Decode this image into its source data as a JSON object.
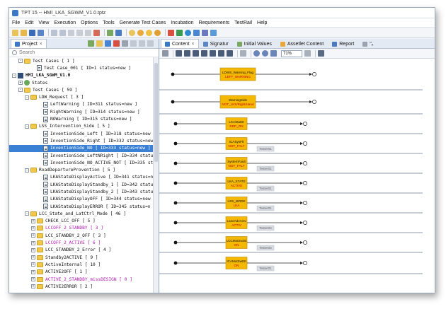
{
  "window": {
    "title": "TPT 15 -- HMI_LKA_SGWM_V1.0.tptz"
  },
  "menu": [
    "File",
    "Edit",
    "View",
    "Execution",
    "Options",
    "Tools",
    "Generate Test Cases",
    "Incubation",
    "Requirements",
    "TestRail",
    "Help"
  ],
  "left_panel": {
    "tab_label": "Project",
    "search_placeholder": "Search",
    "tree": [
      {
        "label": "Test Cases  [ 1 ]",
        "indent": 1,
        "toggle": "-",
        "icon": "folder"
      },
      {
        "label": "Test Case_001  [ ID=1 status=new ]",
        "indent": 3,
        "toggle": "",
        "icon": "testcase"
      },
      {
        "label": "HMI_LKA_SGWM_V1.0",
        "indent": 0,
        "toggle": "-",
        "icon": "package",
        "style": "bold"
      },
      {
        "label": "States",
        "indent": 1,
        "toggle": "+",
        "icon": "states"
      },
      {
        "label": "Test Cases  [ 59 ]",
        "indent": 1,
        "toggle": "-",
        "icon": "folder"
      },
      {
        "label": "LDW_Request  [ 3 ]",
        "indent": 2,
        "toggle": "-",
        "icon": "folder"
      },
      {
        "label": "LeftWarning  [ ID=311 status=new ]",
        "indent": 4,
        "toggle": "",
        "icon": "testcase"
      },
      {
        "label": "RightWarning  [ ID=314 status=new ]",
        "indent": 4,
        "toggle": "",
        "icon": "testcase"
      },
      {
        "label": "NOWarning  [ ID=315 status=new ]",
        "indent": 4,
        "toggle": "",
        "icon": "testcase"
      },
      {
        "label": "LSS_Intervention_Side  [ 5 ]",
        "indent": 2,
        "toggle": "-",
        "icon": "folder"
      },
      {
        "label": "InventionSide_Left  [ ID=318 status=new ]",
        "indent": 4,
        "toggle": "",
        "icon": "testcase"
      },
      {
        "label": "InventionSide_Right  [ ID=332 status=new ]",
        "indent": 4,
        "toggle": "",
        "icon": "testcase"
      },
      {
        "label": "InventionSide_NO  [ ID=333 status=new ]",
        "indent": 4,
        "toggle": "",
        "icon": "testcase",
        "selected": true
      },
      {
        "label": "InventionSide_LeftNRight  [ ID=334 status=n",
        "indent": 4,
        "toggle": "",
        "icon": "testcase"
      },
      {
        "label": "InventionSide_NO_ACTIVE_NOT  [ ID=335 status",
        "indent": 4,
        "toggle": "",
        "icon": "testcase"
      },
      {
        "label": "RoadDepartureProvention  [ 5 ]",
        "indent": 2,
        "toggle": "-",
        "icon": "folder"
      },
      {
        "label": "LKAStateDisplayActive  [ ID=341 status=new",
        "indent": 4,
        "toggle": "",
        "icon": "testcase"
      },
      {
        "label": "LKAStateDisplayStandby_1  [ ID=342 status=n",
        "indent": 4,
        "toggle": "",
        "icon": "testcase"
      },
      {
        "label": "LKAStateDisplayStandby_2  [ ID=343 status=n",
        "indent": 4,
        "toggle": "",
        "icon": "testcase"
      },
      {
        "label": "LKAStateDisplayOFF  [ ID=344 status=new ]",
        "indent": 4,
        "toggle": "",
        "icon": "testcase"
      },
      {
        "label": "LKAStateDisplayERROR  [ ID=345 status=n",
        "indent": 4,
        "toggle": "",
        "icon": "testcase"
      },
      {
        "label": "LCC_State_and_LatCtrl_Mode  [ 46 ]",
        "indent": 2,
        "toggle": "-",
        "icon": "folder"
      },
      {
        "label": "CHECK_LCC_OFF  [ 5 ]",
        "indent": 3,
        "toggle": "+",
        "icon": "folder"
      },
      {
        "label": "LCCOFF_2_STANDBY  [ 3 ]",
        "indent": 3,
        "toggle": "+",
        "icon": "folder",
        "style": "magenta"
      },
      {
        "label": "LCC_STANDBY_2_OFF  [ 3 ]",
        "indent": 3,
        "toggle": "+",
        "icon": "folder"
      },
      {
        "label": "LCCOFF_2_ACTIVE  [ 6 ]",
        "indent": 3,
        "toggle": "+",
        "icon": "folder",
        "style": "magenta"
      },
      {
        "label": "LCC_STANDBY_2_Error  [ 4 ]",
        "indent": 3,
        "toggle": "+",
        "icon": "folder"
      },
      {
        "label": "Standby2ACTIVE  [ 9 ]",
        "indent": 3,
        "toggle": "+",
        "icon": "folder"
      },
      {
        "label": "ActiveInternal  [ 10 ]",
        "indent": 3,
        "toggle": "+",
        "icon": "folder"
      },
      {
        "label": "ACTIVE2OFF  [ 1 ]",
        "indent": 3,
        "toggle": "+",
        "icon": "folder"
      },
      {
        "label": "ACTIVE_2_STANDBY_missDESIGN  [ 0 ]",
        "indent": 3,
        "toggle": "+",
        "icon": "folder",
        "style": "magenta"
      },
      {
        "label": "ACTIVE2ERROR  [ 2 ]",
        "indent": 3,
        "toggle": "+",
        "icon": "folder"
      }
    ]
  },
  "right_panel": {
    "tabs": [
      {
        "label": "Content",
        "active": true,
        "close": true
      },
      {
        "label": "Signatur",
        "active": false
      },
      {
        "label": "Initial Values",
        "active": false
      },
      {
        "label": "Assetlet Content",
        "active": false
      },
      {
        "label": "Report",
        "active": false
      },
      {
        "label": "\"ₓ",
        "active": false
      }
    ],
    "zoom": "71%"
  },
  "diagram": {
    "lanes": [
      {
        "name": "LDWS_Warning_Flag",
        "value": "LEFT_WARNING",
        "tag": ""
      },
      {
        "name": "WarningSide",
        "value": "NOT_LKS/Right/Hand",
        "tag": ""
      },
      {
        "name": "LKAStatSt",
        "value": "RDP_ON",
        "tag": ""
      },
      {
        "name": "ICASysFlt",
        "value": "NOT_FALT",
        "tag": "Tester01"
      },
      {
        "name": "SystemFault",
        "value": "NOT_FALT",
        "tag": "Tester01"
      },
      {
        "name": "LKA_STATE",
        "value": "ACTIVE",
        "tag": "Tester01"
      },
      {
        "name": "LSS_MODE",
        "value": "LKA",
        "tag": "Tester01"
      },
      {
        "name": "LaneAdvActv",
        "value": "ACTIV",
        "tag": "Tester04"
      },
      {
        "name": "LCCMotSwtSt",
        "value": "ON",
        "tag": "Tester04"
      },
      {
        "name": "ICAMotSwtSt",
        "value": "ON",
        "tag": "Tester01"
      }
    ]
  },
  "colors": {
    "block_fill": "#f5b800",
    "block_text": "#cc0000",
    "selection": "#3a80d4",
    "magenta_label": "#b01ab0"
  }
}
